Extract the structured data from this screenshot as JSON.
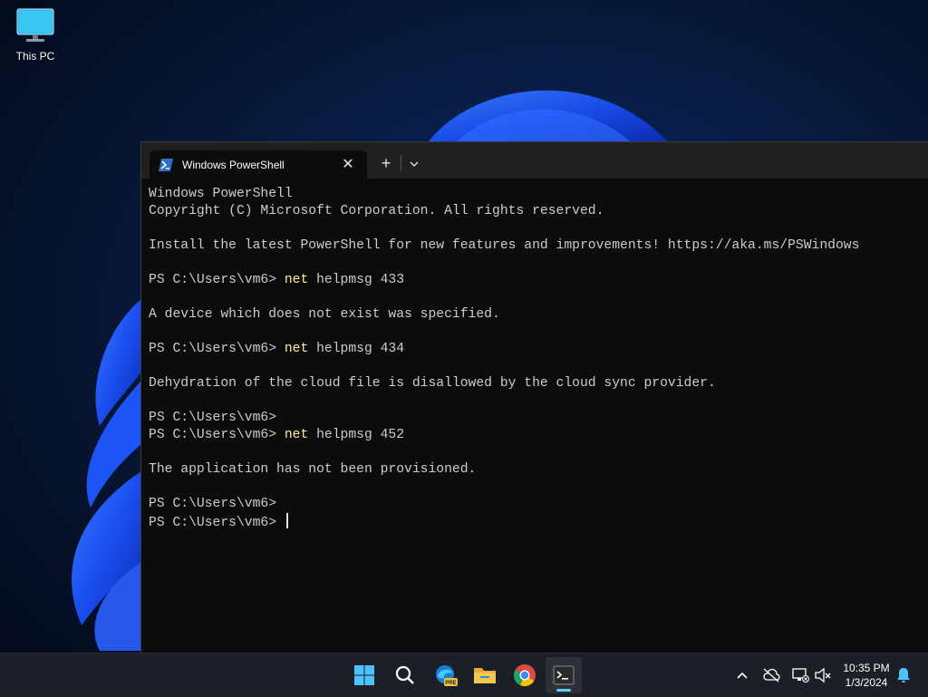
{
  "desktop": {
    "icon_label": "This PC"
  },
  "terminal": {
    "tab_title": "Windows PowerShell",
    "new_tab_symbol": "+",
    "close_symbol": "✕",
    "dropdown_symbol": "⌄",
    "lines": [
      {
        "text": "Windows PowerShell"
      },
      {
        "text": "Copyright (C) Microsoft Corporation. All rights reserved."
      },
      {
        "text": ""
      },
      {
        "text": "Install the latest PowerShell for new features and improvements! https://aka.ms/PSWindows"
      },
      {
        "text": ""
      },
      {
        "prompt": "PS C:\\Users\\vm6> ",
        "cmd": "net",
        "args": " helpmsg 433"
      },
      {
        "text": ""
      },
      {
        "text": "A device which does not exist was specified."
      },
      {
        "text": ""
      },
      {
        "prompt": "PS C:\\Users\\vm6> ",
        "cmd": "net",
        "args": " helpmsg 434"
      },
      {
        "text": ""
      },
      {
        "text": "Dehydration of the cloud file is disallowed by the cloud sync provider."
      },
      {
        "text": ""
      },
      {
        "text": "PS C:\\Users\\vm6>"
      },
      {
        "prompt": "PS C:\\Users\\vm6> ",
        "cmd": "net",
        "args": " helpmsg 452"
      },
      {
        "text": ""
      },
      {
        "text": "The application has not been provisioned."
      },
      {
        "text": ""
      },
      {
        "text": "PS C:\\Users\\vm6>"
      },
      {
        "prompt": "PS C:\\Users\\vm6> ",
        "cursor": true
      }
    ]
  },
  "taskbar": {
    "apps": [
      {
        "name": "start-button",
        "icon": "windows-logo-icon"
      },
      {
        "name": "search-button",
        "icon": "search-icon"
      },
      {
        "name": "edge-beta-button",
        "icon": "edge-beta-icon",
        "badge": "PRE"
      },
      {
        "name": "file-explorer-button",
        "icon": "folder-icon"
      },
      {
        "name": "chrome-button",
        "icon": "chrome-icon"
      },
      {
        "name": "terminal-button",
        "icon": "terminal-icon",
        "active": true
      }
    ],
    "tray": {
      "time": "10:35 PM",
      "date": "1/3/2024"
    }
  },
  "colors": {
    "console_bg": "#0c0c0c",
    "console_text": "#cccccc",
    "command_text": "#f9f1a5",
    "taskbar_bg": "#1c1f26",
    "accent": "#60cdff"
  }
}
